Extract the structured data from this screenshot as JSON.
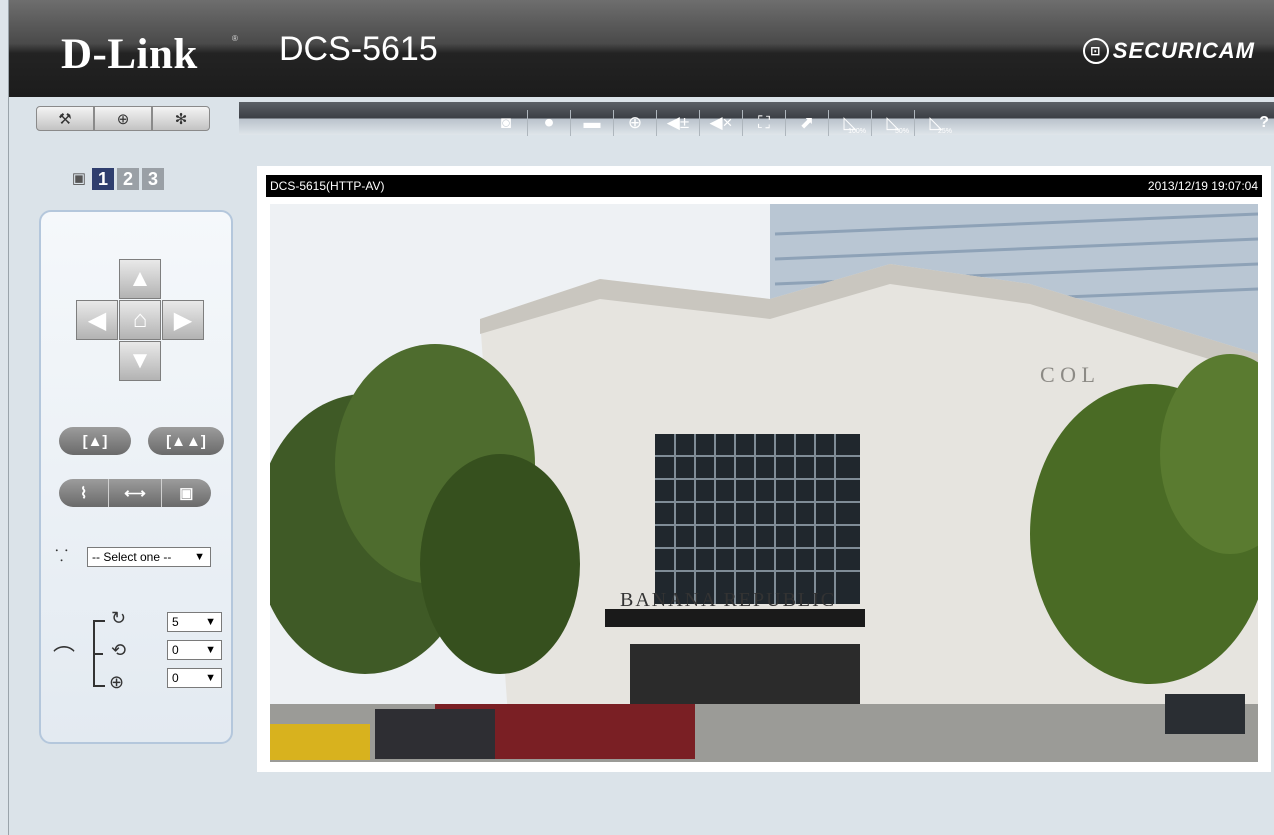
{
  "header": {
    "brand": "D-Link",
    "brand_mark": "®",
    "model": "DCS-5615",
    "securicam_logo": "SECURICAM"
  },
  "setup_buttons": [
    {
      "icon": "user-wrench-icon",
      "glyph": "⚒"
    },
    {
      "icon": "globe-icon",
      "glyph": "⊕"
    },
    {
      "icon": "gear-icon",
      "glyph": "✻"
    }
  ],
  "toolbar": {
    "tools": [
      {
        "name": "snapshot-button",
        "icon": "camera-icon",
        "glyph": "◙"
      },
      {
        "name": "record-button",
        "icon": "record-icon",
        "glyph": "⏺"
      },
      {
        "name": "folder-button",
        "icon": "folder-icon",
        "glyph": "▬"
      },
      {
        "name": "digital-zoom-button",
        "icon": "zoom-in-icon",
        "glyph": "⊕"
      },
      {
        "name": "volume-button",
        "icon": "volume-adjust-icon",
        "glyph": "◀±"
      },
      {
        "name": "mute-button",
        "icon": "mute-icon",
        "glyph": "◀×"
      },
      {
        "name": "fullscreen-button",
        "icon": "fullscreen-icon",
        "glyph": "⛶"
      },
      {
        "name": "fit-button",
        "icon": "fit-window-icon",
        "glyph": "⬈"
      },
      {
        "name": "size-100-button",
        "icon": "size-100-icon",
        "glyph": "◺",
        "sub": "100%"
      },
      {
        "name": "size-50-button",
        "icon": "size-50-icon",
        "glyph": "◺",
        "sub": "50%"
      },
      {
        "name": "size-25-button",
        "icon": "size-25-icon",
        "glyph": "◺",
        "sub": "25%"
      }
    ],
    "help": "?"
  },
  "camera_tabs": [
    "1",
    "2",
    "3"
  ],
  "ptz": {
    "preset_select": "-- Select one --",
    "pan_speed": "5",
    "tilt_speed": "0",
    "zoom_speed": "0"
  },
  "video": {
    "title": "DCS-5615(HTTP-AV)",
    "timestamp": "2013/12/19 19:07:04",
    "sign_text": "BANANA REPUBLIC",
    "facade_text": "C O L"
  },
  "colors": {
    "header_dark": "#1c1c1c",
    "page_bg": "#dbe3e9",
    "active_tab": "#2f3e6e",
    "panel_border": "#b4c7dc"
  }
}
